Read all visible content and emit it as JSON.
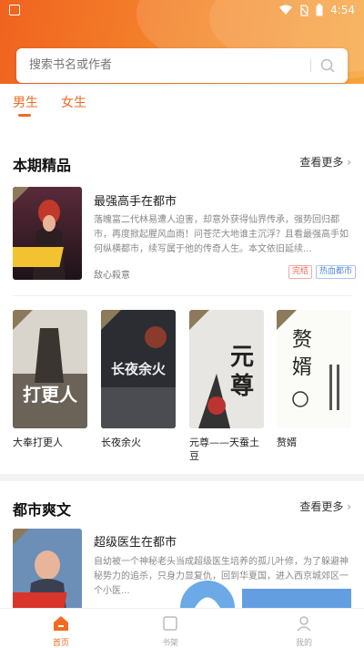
{
  "status_bar": {
    "time": "4:54"
  },
  "search": {
    "placeholder": "搜索书名或作者"
  },
  "tabs": [
    {
      "label": "男生"
    },
    {
      "label": "女生"
    }
  ],
  "section1": {
    "title": "本期精品",
    "more": "查看更多",
    "featured": {
      "title": "最强高手在都市",
      "description": "落魄富二代林易遭人迫害，却意外获得仙界传承，强势回归都市，再度掀起腥风血雨！问苍茫大地谁主沉浮？且看最强高手如何纵横都市，续写属于他的传奇人生。本文依旧延续...",
      "author": "敌心殺意",
      "tags": [
        "完结",
        "热血都市"
      ]
    },
    "books": [
      {
        "title": "大奉打更人"
      },
      {
        "title": "长夜余火"
      },
      {
        "title": "元尊——天蚕土豆"
      },
      {
        "title": "赘婿"
      }
    ]
  },
  "section2": {
    "title": "都市爽文",
    "more": "查看更多",
    "featured": {
      "title": "超级医生在都市",
      "description": "自幼被一个神秘老头当成超级医生培养的孤儿叶修，为了躲避神秘势力的追杀，只身力显复仇，回到华夏国，进入西京城郊区一个小医..."
    }
  },
  "bottom_nav": [
    {
      "label": "首页"
    },
    {
      "label": "书架"
    },
    {
      "label": "我的"
    }
  ],
  "colors": {
    "accent": "#f06a24"
  }
}
